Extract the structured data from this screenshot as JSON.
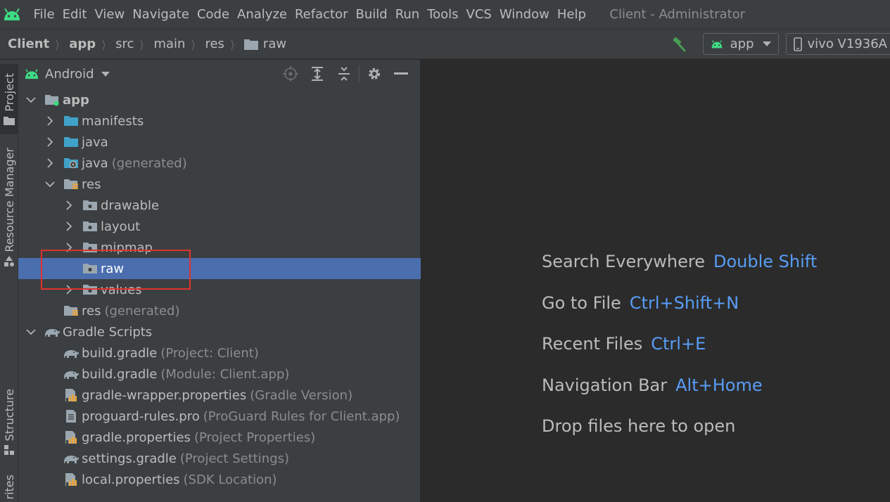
{
  "menubar": {
    "items": [
      "File",
      "Edit",
      "View",
      "Navigate",
      "Code",
      "Analyze",
      "Refactor",
      "Build",
      "Run",
      "Tools",
      "VCS",
      "Window",
      "Help"
    ],
    "window_title": "Client - Administrator"
  },
  "breadcrumb": {
    "items": [
      "Client",
      "app",
      "src",
      "main",
      "res",
      "raw"
    ]
  },
  "toolbar": {
    "run_config": "app",
    "device": "vivo V1936A"
  },
  "left_strip": {
    "tabs": [
      "Project",
      "Resource Manager",
      "Structure",
      "rites"
    ]
  },
  "project_panel": {
    "view_mode": "Android",
    "tree": [
      {
        "label": "app",
        "hint": "",
        "depth": 0,
        "expanded": true,
        "icon": "module-folder-icon"
      },
      {
        "label": "manifests",
        "hint": "",
        "depth": 1,
        "expanded": false,
        "icon": "folder-icon"
      },
      {
        "label": "java",
        "hint": "",
        "depth": 1,
        "expanded": false,
        "icon": "folder-icon"
      },
      {
        "label": "java",
        "hint": "(generated)",
        "depth": 1,
        "expanded": false,
        "icon": "generated-folder-icon"
      },
      {
        "label": "res",
        "hint": "",
        "depth": 1,
        "expanded": true,
        "icon": "res-folder-icon"
      },
      {
        "label": "drawable",
        "hint": "",
        "depth": 2,
        "expanded": false,
        "icon": "res-subfolder-icon"
      },
      {
        "label": "layout",
        "hint": "",
        "depth": 2,
        "expanded": false,
        "icon": "res-subfolder-icon"
      },
      {
        "label": "mipmap",
        "hint": "",
        "depth": 2,
        "expanded": false,
        "icon": "res-subfolder-icon"
      },
      {
        "label": "raw",
        "hint": "",
        "depth": 2,
        "expanded": null,
        "icon": "res-subfolder-icon",
        "selected": true
      },
      {
        "label": "values",
        "hint": "",
        "depth": 2,
        "expanded": false,
        "icon": "res-subfolder-icon"
      },
      {
        "label": "res",
        "hint": "(generated)",
        "depth": 1,
        "expanded": null,
        "icon": "res-folder-icon"
      },
      {
        "label": "Gradle Scripts",
        "hint": "",
        "depth": 0,
        "expanded": true,
        "icon": "gradle-elephant-icon"
      },
      {
        "label": "build.gradle",
        "hint": "(Project: Client)",
        "depth": 1,
        "expanded": null,
        "icon": "gradle-elephant-icon"
      },
      {
        "label": "build.gradle",
        "hint": "(Module: Client.app)",
        "depth": 1,
        "expanded": null,
        "icon": "gradle-elephant-icon"
      },
      {
        "label": "gradle-wrapper.properties",
        "hint": "(Gradle Version)",
        "depth": 1,
        "expanded": null,
        "icon": "properties-file-icon"
      },
      {
        "label": "proguard-rules.pro",
        "hint": "(ProGuard Rules for Client.app)",
        "depth": 1,
        "expanded": null,
        "icon": "text-file-icon"
      },
      {
        "label": "gradle.properties",
        "hint": "(Project Properties)",
        "depth": 1,
        "expanded": null,
        "icon": "properties-file-icon"
      },
      {
        "label": "settings.gradle",
        "hint": "(Project Settings)",
        "depth": 1,
        "expanded": null,
        "icon": "gradle-elephant-icon"
      },
      {
        "label": "local.properties",
        "hint": "(SDK Location)",
        "depth": 1,
        "expanded": null,
        "icon": "properties-file-icon"
      }
    ]
  },
  "editor": {
    "tips": [
      {
        "label": "Search Everywhere",
        "shortcut": "Double Shift"
      },
      {
        "label": "Go to File",
        "shortcut": "Ctrl+Shift+N"
      },
      {
        "label": "Recent Files",
        "shortcut": "Ctrl+E"
      },
      {
        "label": "Navigation Bar",
        "shortcut": "Alt+Home"
      },
      {
        "label": "Drop files here to open",
        "shortcut": ""
      }
    ]
  },
  "colors": {
    "accent": "#589df6",
    "selection": "#4b6eaf",
    "android_green": "#3ddc84",
    "annotation_red": "#e0322e"
  }
}
